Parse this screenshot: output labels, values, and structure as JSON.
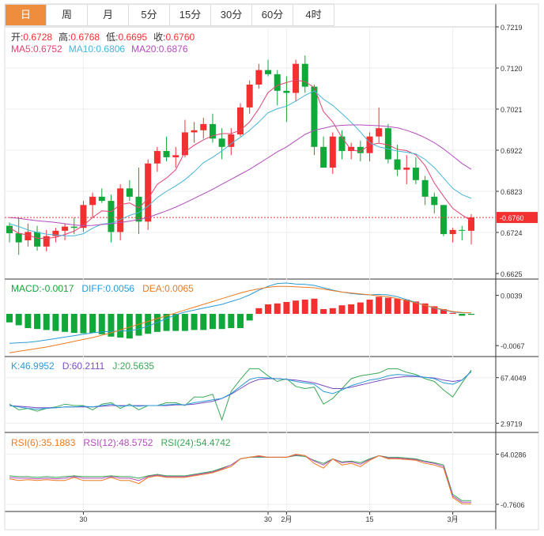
{
  "tabs": [
    "日",
    "周",
    "月",
    "5分",
    "15分",
    "30分",
    "60分",
    "4时"
  ],
  "active_tab": 0,
  "colors": {
    "up": "#f23030",
    "down": "#11a83a",
    "ma5": "#e3436f",
    "ma10": "#46b6d8",
    "ma20": "#b34cbc",
    "macd": "#11a83a",
    "diff": "#2a9bd8",
    "dea": "#ee7a20",
    "k": "#2a9bd8",
    "d": "#7a4cc0",
    "j": "#3aa855",
    "rsi6": "#ee7a20",
    "rsi12": "#b34cbc",
    "rsi24": "#3aa855",
    "last": "#f23030"
  },
  "info": {
    "ohlc": [
      {
        "label": "开:",
        "value": "0.6728"
      },
      {
        "label": "高:",
        "value": "0.6768"
      },
      {
        "label": "低:",
        "value": "0.6695"
      },
      {
        "label": "收:",
        "value": "0.6760"
      }
    ],
    "ma": [
      {
        "label": "MA5:",
        "value": "0.6752",
        "color": "ma5"
      },
      {
        "label": "MA10:",
        "value": "0.6806",
        "color": "ma10"
      },
      {
        "label": "MA20:",
        "value": "0.6876",
        "color": "ma20"
      }
    ],
    "macd": [
      {
        "label": "MACD:",
        "value": "-0.0017",
        "color": "macd"
      },
      {
        "label": "DIFF:",
        "value": "0.0056",
        "color": "diff"
      },
      {
        "label": "DEA:",
        "value": "0.0065",
        "color": "dea"
      }
    ],
    "kdj": [
      {
        "label": "K:",
        "value": "46.9952",
        "color": "k"
      },
      {
        "label": "D:",
        "value": "60.2111",
        "color": "d"
      },
      {
        "label": "J:",
        "value": "20.5635",
        "color": "j"
      }
    ],
    "rsi": [
      {
        "label": "RSI(6):",
        "value": "35.1883",
        "color": "rsi6"
      },
      {
        "label": "RSI(12):",
        "value": "48.5752",
        "color": "rsi12"
      },
      {
        "label": "RSI(24):",
        "value": "54.4742",
        "color": "rsi24"
      }
    ]
  },
  "chart_data": {
    "type": "candlestick",
    "x_ticks": [
      {
        "index": 8,
        "label": "30"
      },
      {
        "index": 28,
        "label": "30"
      },
      {
        "index": 30,
        "label": "2月"
      },
      {
        "index": 39,
        "label": "15"
      },
      {
        "index": 48,
        "label": "3月"
      }
    ],
    "price": {
      "ylim": [
        0.6625,
        0.7219
      ],
      "ticks": [
        "0.7219",
        "0.7120",
        "0.7021",
        "0.6922",
        "0.6823",
        "0.6724",
        "0.6625"
      ],
      "last": 0.676,
      "last_label": "0.6760",
      "ohlc": [
        [
          0.674,
          0.6748,
          0.67,
          0.6722
        ],
        [
          0.6722,
          0.676,
          0.667,
          0.67
        ],
        [
          0.6705,
          0.6745,
          0.669,
          0.6725
        ],
        [
          0.6725,
          0.674,
          0.668,
          0.669
        ],
        [
          0.669,
          0.673,
          0.6678,
          0.6715
        ],
        [
          0.6715,
          0.6735,
          0.67,
          0.6728
        ],
        [
          0.6728,
          0.6745,
          0.6705,
          0.6738
        ],
        [
          0.6738,
          0.676,
          0.672,
          0.6735
        ],
        [
          0.6735,
          0.68,
          0.6725,
          0.679
        ],
        [
          0.679,
          0.682,
          0.676,
          0.681
        ],
        [
          0.681,
          0.683,
          0.6795,
          0.68
        ],
        [
          0.68,
          0.6815,
          0.67,
          0.6725
        ],
        [
          0.6725,
          0.684,
          0.6705,
          0.683
        ],
        [
          0.683,
          0.685,
          0.68,
          0.681
        ],
        [
          0.681,
          0.688,
          0.672,
          0.675
        ],
        [
          0.675,
          0.69,
          0.673,
          0.689
        ],
        [
          0.689,
          0.693,
          0.687,
          0.692
        ],
        [
          0.692,
          0.6955,
          0.6895,
          0.6905
        ],
        [
          0.6905,
          0.693,
          0.688,
          0.691
        ],
        [
          0.691,
          0.6995,
          0.6905,
          0.6965
        ],
        [
          0.6965,
          0.699,
          0.694,
          0.697
        ],
        [
          0.697,
          0.7,
          0.695,
          0.6985
        ],
        [
          0.6985,
          0.701,
          0.694,
          0.695
        ],
        [
          0.695,
          0.6975,
          0.69,
          0.693
        ],
        [
          0.693,
          0.6975,
          0.691,
          0.696
        ],
        [
          0.696,
          0.7035,
          0.6955,
          0.7025
        ],
        [
          0.7025,
          0.709,
          0.701,
          0.708
        ],
        [
          0.708,
          0.713,
          0.707,
          0.7115
        ],
        [
          0.7115,
          0.714,
          0.71,
          0.7105
        ],
        [
          0.7105,
          0.7115,
          0.703,
          0.7065
        ],
        [
          0.7065,
          0.71,
          0.699,
          0.706
        ],
        [
          0.706,
          0.714,
          0.704,
          0.713
        ],
        [
          0.713,
          0.715,
          0.706,
          0.7075
        ],
        [
          0.7075,
          0.708,
          0.691,
          0.693
        ],
        [
          0.693,
          0.6955,
          0.689,
          0.688
        ],
        [
          0.688,
          0.6965,
          0.6865,
          0.6955
        ],
        [
          0.6955,
          0.697,
          0.69,
          0.692
        ],
        [
          0.692,
          0.694,
          0.69,
          0.693
        ],
        [
          0.693,
          0.6945,
          0.6895,
          0.6915
        ],
        [
          0.6915,
          0.6965,
          0.6895,
          0.6955
        ],
        [
          0.6955,
          0.7025,
          0.694,
          0.6975
        ],
        [
          0.6975,
          0.6985,
          0.689,
          0.69
        ],
        [
          0.69,
          0.6935,
          0.686,
          0.6875
        ],
        [
          0.6875,
          0.691,
          0.684,
          0.688
        ],
        [
          0.688,
          0.6905,
          0.684,
          0.685
        ],
        [
          0.685,
          0.686,
          0.679,
          0.681
        ],
        [
          0.681,
          0.682,
          0.677,
          0.679
        ],
        [
          0.679,
          0.679,
          0.6715,
          0.672
        ],
        [
          0.672,
          0.6735,
          0.67,
          0.673
        ],
        [
          0.673,
          0.674,
          0.6705,
          0.6728
        ],
        [
          0.6728,
          0.6768,
          0.6695,
          0.676
        ]
      ],
      "ma5": [
        0.6735,
        0.6722,
        0.6718,
        0.671,
        0.671,
        0.6712,
        0.6719,
        0.6727,
        0.6741,
        0.676,
        0.6776,
        0.6774,
        0.6791,
        0.6795,
        0.6783,
        0.6805,
        0.684,
        0.6855,
        0.6875,
        0.6918,
        0.6934,
        0.6947,
        0.6957,
        0.6962,
        0.6962,
        0.697,
        0.699,
        0.7022,
        0.7061,
        0.7078,
        0.7085,
        0.7091,
        0.7087,
        0.7073,
        0.7015,
        0.699,
        0.6952,
        0.6923,
        0.6919,
        0.6935,
        0.6939,
        0.6935,
        0.6924,
        0.6921,
        0.6911,
        0.6885,
        0.6843,
        0.6811,
        0.6782,
        0.6766,
        0.6752
      ],
      "ma10": [
        0.6745,
        0.6738,
        0.673,
        0.6724,
        0.672,
        0.6718,
        0.6716,
        0.6716,
        0.6721,
        0.6734,
        0.6744,
        0.6746,
        0.6755,
        0.6765,
        0.6772,
        0.6787,
        0.6808,
        0.6823,
        0.6836,
        0.6851,
        0.687,
        0.6892,
        0.6905,
        0.692,
        0.6938,
        0.6953,
        0.697,
        0.699,
        0.7012,
        0.7022,
        0.7028,
        0.704,
        0.7054,
        0.7065,
        0.7045,
        0.703,
        0.701,
        0.6989,
        0.6966,
        0.694,
        0.693,
        0.6925,
        0.692,
        0.6917,
        0.6913,
        0.69,
        0.688,
        0.6855,
        0.683,
        0.6815,
        0.6806
      ],
      "ma20": [
        0.676,
        0.6758,
        0.6755,
        0.6752,
        0.675,
        0.6748,
        0.6745,
        0.6742,
        0.674,
        0.6741,
        0.6743,
        0.6745,
        0.6748,
        0.6751,
        0.6755,
        0.676,
        0.6768,
        0.6776,
        0.6785,
        0.6795,
        0.6806,
        0.6817,
        0.6828,
        0.684,
        0.6852,
        0.6864,
        0.6876,
        0.689,
        0.6904,
        0.6918,
        0.693,
        0.6945,
        0.696,
        0.697,
        0.6975,
        0.698,
        0.6982,
        0.6983,
        0.6983,
        0.6982,
        0.6981,
        0.6979,
        0.6976,
        0.697,
        0.6962,
        0.6952,
        0.694,
        0.6925,
        0.6908,
        0.689,
        0.6876
      ]
    },
    "macd": {
      "ylim": [
        -0.009,
        0.007
      ],
      "ticks": [
        {
          "value": 0.0039,
          "label": "0.0039"
        },
        {
          "value": -0.0067,
          "label": "-0.0067"
        }
      ],
      "hist": [
        -0.0018,
        -0.0024,
        -0.003,
        -0.0032,
        -0.0034,
        -0.0036,
        -0.0038,
        -0.004,
        -0.0041,
        -0.004,
        -0.0043,
        -0.0048,
        -0.005,
        -0.0052,
        -0.0046,
        -0.0042,
        -0.0038,
        -0.0036,
        -0.0036,
        -0.0036,
        -0.0034,
        -0.0034,
        -0.0032,
        -0.0032,
        -0.003,
        -0.003,
        -0.0014,
        0.0012,
        0.002,
        0.0022,
        0.0025,
        0.0028,
        0.003,
        0.0032,
        0.001,
        0.0012,
        0.0018,
        0.002,
        0.0024,
        0.003,
        0.0036,
        0.0034,
        0.0032,
        0.003,
        0.0026,
        0.0022,
        0.0016,
        0.001,
        0.0002,
        -0.0004,
        -0.0002
      ],
      "diff": [
        -0.0062,
        -0.0061,
        -0.006,
        -0.0058,
        -0.0055,
        -0.0052,
        -0.0049,
        -0.0046,
        -0.0043,
        -0.004,
        -0.0038,
        -0.0037,
        -0.0036,
        -0.0036,
        -0.0032,
        -0.0026,
        -0.0018,
        -0.001,
        -0.0002,
        0.0004,
        0.0008,
        0.0012,
        0.0016,
        0.002,
        0.0026,
        0.0032,
        0.004,
        0.005,
        0.0058,
        0.0064,
        0.0065,
        0.0063,
        0.0062,
        0.006,
        0.0055,
        0.005,
        0.0046,
        0.0043,
        0.0041,
        0.004,
        0.0041,
        0.004,
        0.0036,
        0.003,
        0.0024,
        0.0018,
        0.0012,
        0.0008,
        0.0004,
        0.0002,
        0.0002
      ],
      "dea": [
        -0.0082,
        -0.0079,
        -0.0076,
        -0.0073,
        -0.007,
        -0.0066,
        -0.0062,
        -0.0058,
        -0.0054,
        -0.005,
        -0.0045,
        -0.004,
        -0.0034,
        -0.0028,
        -0.0022,
        -0.0016,
        -0.001,
        -0.0004,
        0.0002,
        0.0008,
        0.0014,
        0.002,
        0.0026,
        0.0032,
        0.0038,
        0.0044,
        0.0049,
        0.0053,
        0.0056,
        0.0058,
        0.0058,
        0.0057,
        0.0056,
        0.0055,
        0.0052,
        0.0049,
        0.0046,
        0.0044,
        0.0042,
        0.004,
        0.0038,
        0.0036,
        0.0032,
        0.0028,
        0.0023,
        0.0018,
        0.0013,
        0.0009,
        0.0005,
        0.0003,
        0.0002
      ]
    },
    "kdj": {
      "ylim": [
        -10,
        95
      ],
      "ticks": [
        {
          "value": 67.4049,
          "label": "67.4049"
        },
        {
          "value": 2.9719,
          "label": "2.9719"
        }
      ],
      "k": [
        28,
        26,
        24,
        23,
        24,
        25,
        26,
        26,
        27,
        26,
        28,
        30,
        27,
        28,
        27,
        28,
        28,
        29,
        30,
        29,
        32,
        34,
        36,
        38,
        45,
        55,
        65,
        68,
        67,
        66,
        65,
        62,
        60,
        58,
        48,
        45,
        50,
        56,
        60,
        64,
        66,
        70,
        72,
        71,
        70,
        68,
        66,
        60,
        58,
        64,
        76
      ],
      "d": [
        28,
        27,
        26,
        25,
        25,
        25,
        26,
        26,
        26,
        26,
        27,
        28,
        28,
        28,
        28,
        28,
        28,
        28,
        29,
        29,
        30,
        32,
        34,
        38,
        44,
        52,
        60,
        65,
        66,
        66,
        65,
        64,
        62,
        60,
        56,
        52,
        52,
        54,
        57,
        60,
        63,
        66,
        68,
        69,
        69,
        68,
        67,
        64,
        62,
        64,
        76
      ],
      "j": [
        30,
        22,
        24,
        20,
        24,
        26,
        30,
        28,
        28,
        22,
        30,
        32,
        24,
        30,
        22,
        28,
        28,
        32,
        32,
        28,
        40,
        40,
        44,
        8,
        48,
        65,
        80,
        80,
        70,
        62,
        66,
        55,
        52,
        54,
        30,
        38,
        52,
        66,
        70,
        72,
        74,
        80,
        80,
        75,
        72,
        66,
        62,
        50,
        40,
        60,
        78
      ]
    },
    "rsi": {
      "ylim": [
        -10,
        90
      ],
      "ticks": [
        {
          "value": 64.0286,
          "label": "64.0286"
        },
        {
          "value": -0.7606,
          "label": "-0.7606"
        }
      ],
      "rsi6": [
        32,
        30,
        31,
        30,
        31,
        30,
        30,
        34,
        30,
        30,
        30,
        34,
        30,
        30,
        26,
        34,
        36,
        34,
        34,
        34,
        36,
        38,
        40,
        44,
        48,
        58,
        60,
        62,
        60,
        60,
        60,
        64,
        62,
        52,
        46,
        58,
        50,
        52,
        48,
        56,
        62,
        58,
        58,
        57,
        56,
        52,
        50,
        46,
        8,
        0,
        0
      ],
      "rsi12": [
        34,
        33,
        33,
        32,
        33,
        32,
        33,
        35,
        33,
        33,
        33,
        35,
        33,
        33,
        30,
        35,
        37,
        35,
        35,
        35,
        37,
        39,
        41,
        45,
        50,
        58,
        60,
        61,
        60,
        60,
        60,
        63,
        62,
        55,
        50,
        58,
        53,
        54,
        51,
        57,
        62,
        59,
        59,
        58,
        57,
        54,
        52,
        48,
        10,
        2,
        2
      ],
      "rsi24": [
        36,
        35,
        35,
        34,
        35,
        34,
        35,
        36,
        35,
        35,
        35,
        36,
        35,
        35,
        33,
        36,
        38,
        36,
        36,
        36,
        38,
        40,
        42,
        46,
        50,
        58,
        60,
        60,
        60,
        60,
        60,
        62,
        61,
        56,
        52,
        58,
        54,
        55,
        53,
        58,
        62,
        60,
        60,
        59,
        58,
        55,
        53,
        50,
        12,
        4,
        4
      ]
    }
  }
}
